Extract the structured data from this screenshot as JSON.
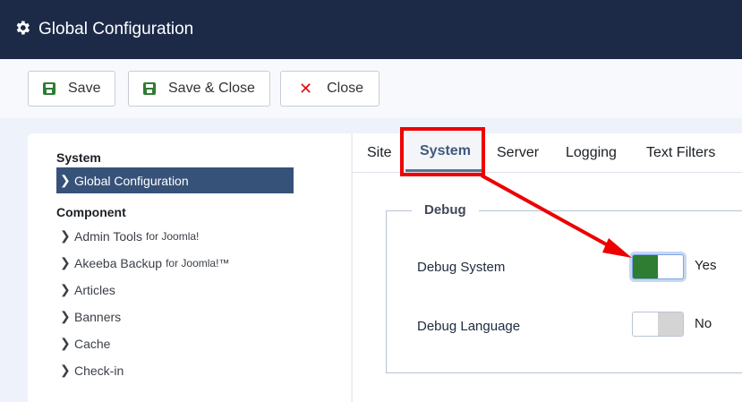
{
  "header": {
    "title": "Global Configuration",
    "icon": "gear-icon"
  },
  "toolbar": {
    "save": "Save",
    "save_close": "Save & Close",
    "close": "Close"
  },
  "sidebar": {
    "system_heading": "System",
    "active_item": "Global Configuration",
    "component_heading": "Component",
    "items": [
      {
        "label": "Admin Tools",
        "suffix": "for Joomla!"
      },
      {
        "label": "Akeeba Backup",
        "suffix": "for Joomla!™"
      },
      {
        "label": "Articles",
        "suffix": ""
      },
      {
        "label": "Banners",
        "suffix": ""
      },
      {
        "label": "Cache",
        "suffix": ""
      },
      {
        "label": "Check-in",
        "suffix": ""
      }
    ]
  },
  "tabs": [
    "Site",
    "System",
    "Server",
    "Logging",
    "Text Filters"
  ],
  "active_tab": "System",
  "debug": {
    "legend": "Debug",
    "rows": [
      {
        "label": "Debug System",
        "value": "Yes",
        "on": true
      },
      {
        "label": "Debug Language",
        "value": "No",
        "on": false
      }
    ]
  },
  "colors": {
    "header": "#1c2a48",
    "active": "#375279",
    "toggle_on": "#2e7d32",
    "annotation": "#ee0000"
  }
}
